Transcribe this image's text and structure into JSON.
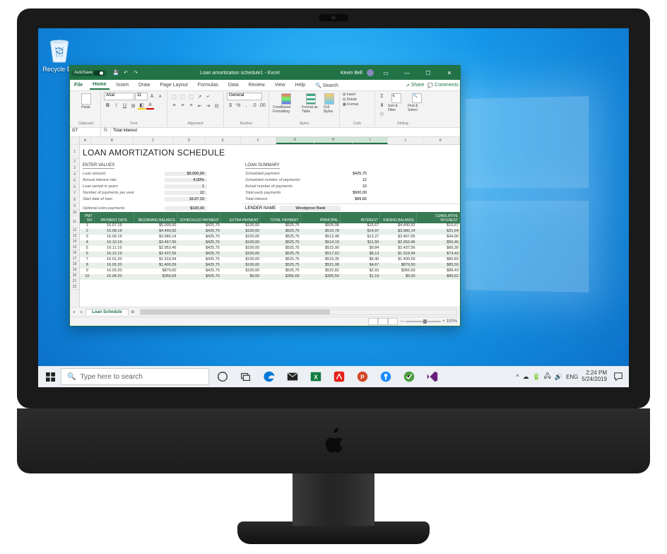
{
  "desktop": {
    "recycle_bin_label": "Recycle Bin"
  },
  "excel": {
    "autosave_label": "AutoSave",
    "title": "Loan amortization schedule1 - Excel",
    "user": "Kevin Bell",
    "menus": {
      "file": "File",
      "home": "Home",
      "insert": "Insert",
      "draw": "Draw",
      "page_layout": "Page Layout",
      "formulas": "Formulas",
      "data": "Data",
      "review": "Review",
      "view": "View",
      "help": "Help",
      "search": "Search"
    },
    "share": "Share",
    "comments": "Comments",
    "ribbon": {
      "clipboard_label": "Clipboard",
      "paste_label": "Paste",
      "font_label": "Font",
      "font_name": "Arial",
      "font_size": "11",
      "alignment_label": "Alignment",
      "number_label": "Number",
      "number_format": "General",
      "styles_label": "Styles",
      "cond_fmt": "Conditional Formatting",
      "fmt_table": "Format as Table",
      "cell_styles": "Cell Styles",
      "cells_label": "Cells",
      "insert_c": "Insert",
      "delete_c": "Delete",
      "format_c": "Format",
      "editing_label": "Editing",
      "sort_filter": "Sort & Filter",
      "find_select": "Find & Select"
    },
    "formula": {
      "name": "G7",
      "value": "Total interest"
    },
    "cols": [
      "A",
      "B",
      "C",
      "D",
      "E",
      "F",
      "G",
      "H",
      "I",
      "J",
      "K"
    ],
    "doc_title": "LOAN AMORTIZATION SCHEDULE",
    "enter_values_label": "ENTER VALUES",
    "loan_summary_label": "LOAN SUMMARY",
    "values": {
      "loan_amount_k": "Loan amount",
      "loan_amount_v": "$5.000,00",
      "interest_k": "Annual interest rate",
      "interest_v": "4,00%",
      "period_k": "Loan period in years",
      "period_v": "1",
      "npy_k": "Number of payments per year",
      "npy_v": "12",
      "start_k": "Start date of loan",
      "start_v": "16.07.19",
      "extra_k": "Optional extra payments",
      "extra_v": "$100,00"
    },
    "summary": {
      "sched_k": "Scheduled payment",
      "sched_v": "$425,75",
      "nsched_k": "Scheduled number of payments",
      "nsched_v": "12",
      "nactual_k": "Actual number of payments",
      "nactual_v": "10",
      "early_k": "Total early payments",
      "early_v": "$900,00",
      "totint_k": "Total interest",
      "totint_v": "$89,82"
    },
    "lender_label": "LENDER NAME",
    "lender_value": "Woodgrove Bank",
    "pay_headers": [
      "PMT NO",
      "PAYMENT DATE",
      "BEGINNING BALANCE",
      "SCHEDULED PAYMENT",
      "EXTRA PAYMENT",
      "TOTAL PAYMENT",
      "PRINCIPAL",
      "INTEREST",
      "ENDING BALANCE",
      "CUMULATIVE INTEREST"
    ],
    "payments": [
      [
        "1",
        "16.07.19",
        "$5.000,00",
        "$425,75",
        "$100,00",
        "$525,75",
        "$509,08",
        "$16,67",
        "$4.490,92",
        "$16,67"
      ],
      [
        "2",
        "16.08.19",
        "$4.490,92",
        "$425,75",
        "$100,00",
        "$525,75",
        "$510,78",
        "$14,97",
        "$3.980,14",
        "$31,64"
      ],
      [
        "3",
        "16.09.19",
        "$3.980,14",
        "$425,75",
        "$100,00",
        "$525,75",
        "$512,48",
        "$13,27",
        "$3.467,65",
        "$44,90"
      ],
      [
        "4",
        "16.10.19",
        "$3.467,65",
        "$425,75",
        "$100,00",
        "$525,75",
        "$514,19",
        "$11,56",
        "$2.953,46",
        "$56,46"
      ],
      [
        "5",
        "16.11.19",
        "$2.953,46",
        "$425,75",
        "$100,00",
        "$525,75",
        "$515,90",
        "$9,84",
        "$2.437,56",
        "$66,30"
      ],
      [
        "6",
        "16.12.19",
        "$2.437,56",
        "$425,75",
        "$100,00",
        "$525,75",
        "$517,62",
        "$8,13",
        "$1.919,94",
        "$74,43"
      ],
      [
        "7",
        "16.01.20",
        "$1.919,94",
        "$425,75",
        "$100,00",
        "$525,75",
        "$519,35",
        "$6,40",
        "$1.400,59",
        "$80,83"
      ],
      [
        "8",
        "16.02.20",
        "$1.400,59",
        "$425,75",
        "$100,00",
        "$525,75",
        "$521,08",
        "$4,67",
        "$879,50",
        "$85,50"
      ],
      [
        "9",
        "16.03.20",
        "$879,50",
        "$425,75",
        "$100,00",
        "$525,75",
        "$522,82",
        "$2,93",
        "$356,69",
        "$88,43"
      ],
      [
        "10",
        "16.04.20",
        "$356,69",
        "$425,75",
        "$0,00",
        "$356,69",
        "$355,50",
        "$1,19",
        "$0,00",
        "$89,62"
      ]
    ],
    "sheet_tab": "Loan Schedule",
    "zoom": "100%"
  },
  "taskbar": {
    "search_placeholder": "Type here to search",
    "lang": "ENG",
    "time": "2:24 PM",
    "date": "5/24/2019",
    "chevron": "^"
  }
}
